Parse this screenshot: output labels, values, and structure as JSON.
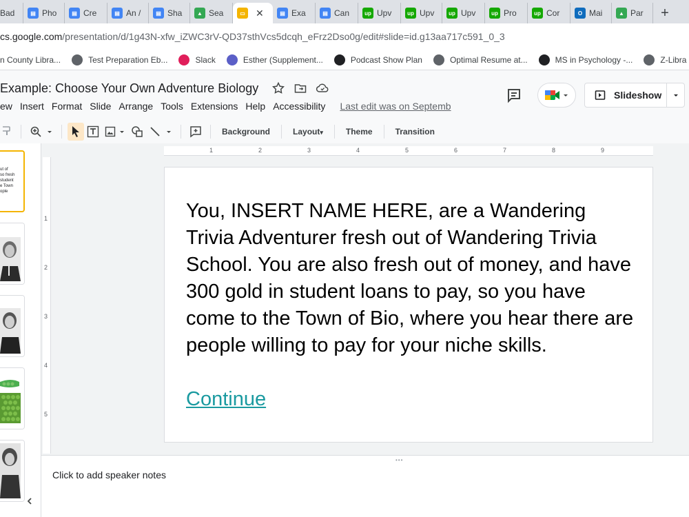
{
  "browser": {
    "tabs": [
      {
        "label": "Bad",
        "icon": "docs-icon",
        "color": "#4285f4",
        "glyph": "▤"
      },
      {
        "label": "Pho",
        "icon": "docs-icon",
        "color": "#4285f4",
        "glyph": "▤"
      },
      {
        "label": "Cre",
        "icon": "docs-icon",
        "color": "#4285f4",
        "glyph": "▤"
      },
      {
        "label": "An /",
        "icon": "docs-icon",
        "color": "#4285f4",
        "glyph": "▤"
      },
      {
        "label": "Sha",
        "icon": "docs-icon",
        "color": "#4285f4",
        "glyph": "▤"
      },
      {
        "label": "Sea",
        "icon": "drive-icon",
        "color": "#34a853",
        "glyph": "▲"
      },
      {
        "label": "",
        "icon": "slides-icon",
        "color": "#f4b400",
        "glyph": "▭",
        "active": true
      },
      {
        "label": "Exa",
        "icon": "docs-icon",
        "color": "#4285f4",
        "glyph": "▤"
      },
      {
        "label": "Can",
        "icon": "docs-icon",
        "color": "#4285f4",
        "glyph": "▤"
      },
      {
        "label": "Upv",
        "icon": "upwork-icon",
        "color": "#14a800",
        "glyph": "up"
      },
      {
        "label": "Upv",
        "icon": "upwork-icon",
        "color": "#14a800",
        "glyph": "up"
      },
      {
        "label": "Upv",
        "icon": "upwork-icon",
        "color": "#14a800",
        "glyph": "up"
      },
      {
        "label": "Pro",
        "icon": "upwork-icon",
        "color": "#14a800",
        "glyph": "up"
      },
      {
        "label": "Cor",
        "icon": "upwork-icon",
        "color": "#14a800",
        "glyph": "up"
      },
      {
        "label": "Mai",
        "icon": "outlook-icon",
        "color": "#0f6cbd",
        "glyph": "O"
      },
      {
        "label": "Par",
        "icon": "drive-icon",
        "color": "#34a853",
        "glyph": "▲"
      }
    ],
    "new_tab_label": "+",
    "url_host": "cs.google.com",
    "url_path": "/presentation/d/1g43N-xfw_iZWC3rV-QD37sthVcs5dcqh_eFrz2Dso0g/edit#slide=id.g13aa717c591_0_3",
    "bookmarks": [
      {
        "label": "n County Libra...",
        "icon": "",
        "color": ""
      },
      {
        "label": "Test Preparation Eb...",
        "icon": "globe-icon",
        "color": "#5f6368"
      },
      {
        "label": "Slack",
        "icon": "slack-icon",
        "color": "#e01e5a"
      },
      {
        "label": "Esther (Supplement...",
        "icon": "teams-icon",
        "color": "#5b5fc7"
      },
      {
        "label": "Podcast Show Plan",
        "icon": "notion-icon",
        "color": "#202124"
      },
      {
        "label": "Optimal Resume at...",
        "icon": "globe-icon",
        "color": "#5f6368"
      },
      {
        "label": "MS in Psychology -...",
        "icon": "university-icon",
        "color": "#202124"
      },
      {
        "label": "Z-Libra",
        "icon": "zlib-icon",
        "color": "#5f6368"
      }
    ]
  },
  "docs": {
    "title": "Example: Choose Your Own Adventure Biology",
    "menu": [
      "ew",
      "Insert",
      "Format",
      "Slide",
      "Arrange",
      "Tools",
      "Extensions",
      "Help",
      "Accessibility"
    ],
    "last_edit": "Last edit was on Septemb",
    "slideshow_label": "Slideshow"
  },
  "toolbar": {
    "background": "Background",
    "layout": "Layout",
    "theme": "Theme",
    "transition": "Transition"
  },
  "filmstrip": {
    "selected_thumb_text": "ut of\nso fresh\nstudent\ne Town\nople"
  },
  "ruler": {
    "h_numbers": [
      "1",
      "2",
      "3",
      "4",
      "5",
      "6",
      "7",
      "8",
      "9"
    ],
    "v_numbers": [
      "1",
      "2",
      "3",
      "4",
      "5"
    ]
  },
  "slide": {
    "body": "You, INSERT NAME HERE, are a Wandering Trivia Adventurer fresh out of Wandering Trivia School. You are also fresh out of money, and have 300 gold in student loans to pay, so you have come to the Town of Bio, where you hear there are people willing to pay for your niche skills.",
    "link": "Continue"
  },
  "notes": {
    "placeholder": "Click to add speaker notes"
  },
  "colors": {
    "accent_selected": "#f4b400",
    "link": "#1a9aa0"
  }
}
